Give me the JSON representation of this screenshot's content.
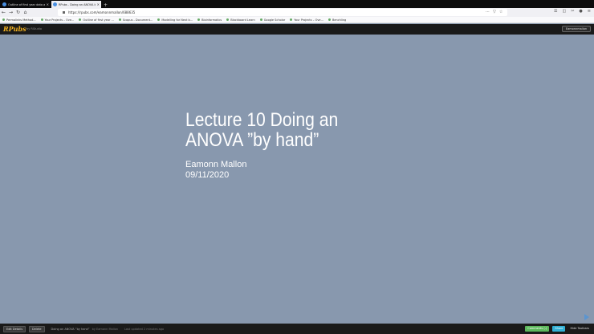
{
  "browser": {
    "tabs": [
      {
        "title": "Outline of first year data anal...",
        "close": "×"
      },
      {
        "title": "RPubs - Doing an ANOVA  by h...",
        "close": "×"
      }
    ],
    "new_tab": "+",
    "url": "https://rpubs.com/eamonnmallon/688635",
    "bookmarks": [
      {
        "label": "Permalinks Method..."
      },
      {
        "label": "Your Projects – Ove..."
      },
      {
        "label": "Outline of first year ..."
      },
      {
        "label": "Scopus - Document..."
      },
      {
        "label": "Modelling for Next b..."
      },
      {
        "label": "Bioinformatics"
      },
      {
        "label": "Blackboard Learn"
      },
      {
        "label": "Google Scholar"
      },
      {
        "label": "Your Projects – Ove..."
      },
      {
        "label": "Benchling"
      }
    ]
  },
  "header": {
    "logo": "RPubs",
    "subtitle": "by RStudio",
    "user": "Eamonnmallon"
  },
  "slide": {
    "title": "Lecture 10 Doing an ANOVA ”by hand”",
    "author": "Eamonn Mallon",
    "date": "09/11/2020"
  },
  "footer": {
    "edit_details": "Edit Details",
    "delete": "Delete",
    "doc_title": "Doing an ANOVA ”by hand”",
    "by": "by Eamonn Mallon",
    "updated": "Last updated 2 minutes ago",
    "comments": "Comments (-)",
    "share": "Share",
    "hide_toolbars": "Hide Toolbars"
  },
  "colors": {
    "slide_bg": "#8898ae",
    "logo": "#f0b020",
    "comments_btn": "#5cb85c",
    "share_btn": "#31b0d5",
    "next_arrow": "#5b95d0"
  },
  "icons": {
    "back": "arrow-left-icon",
    "forward": "arrow-right-icon",
    "reload": "reload-icon",
    "home": "home-icon",
    "next": "next-slide-icon"
  }
}
